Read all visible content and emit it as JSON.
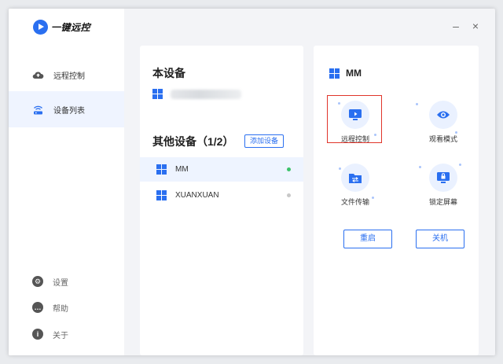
{
  "app": {
    "title": "一键远控"
  },
  "sidebar": {
    "items": [
      {
        "label": "远程控制",
        "icon": "cloud-icon"
      },
      {
        "label": "设备列表",
        "icon": "router-icon"
      }
    ],
    "bottom": [
      {
        "label": "设置",
        "icon": "gear-icon"
      },
      {
        "label": "帮助",
        "icon": "help-icon"
      },
      {
        "label": "关于",
        "icon": "info-icon"
      }
    ]
  },
  "window_controls": {
    "minimize": "–",
    "close": "×"
  },
  "devices": {
    "local_title": "本设备",
    "other_title": "其他设备（1/2）",
    "add_label": "添加设备",
    "list": [
      {
        "name": "MM",
        "status": "online",
        "status_color": "#3cc26b"
      },
      {
        "name": "XUANXUAN",
        "status": "offline",
        "status_color": "#c8c8c8"
      }
    ]
  },
  "detail": {
    "name": "MM",
    "actions": [
      {
        "label": "远程控制",
        "icon": "monitor-icon"
      },
      {
        "label": "观看模式",
        "icon": "eye-icon"
      },
      {
        "label": "文件传输",
        "icon": "folder-icon"
      },
      {
        "label": "锁定屏幕",
        "icon": "lock-icon"
      }
    ],
    "restart_label": "重启",
    "shutdown_label": "关机"
  },
  "colors": {
    "accent": "#2a6ff0",
    "highlight": "#e0352b"
  }
}
